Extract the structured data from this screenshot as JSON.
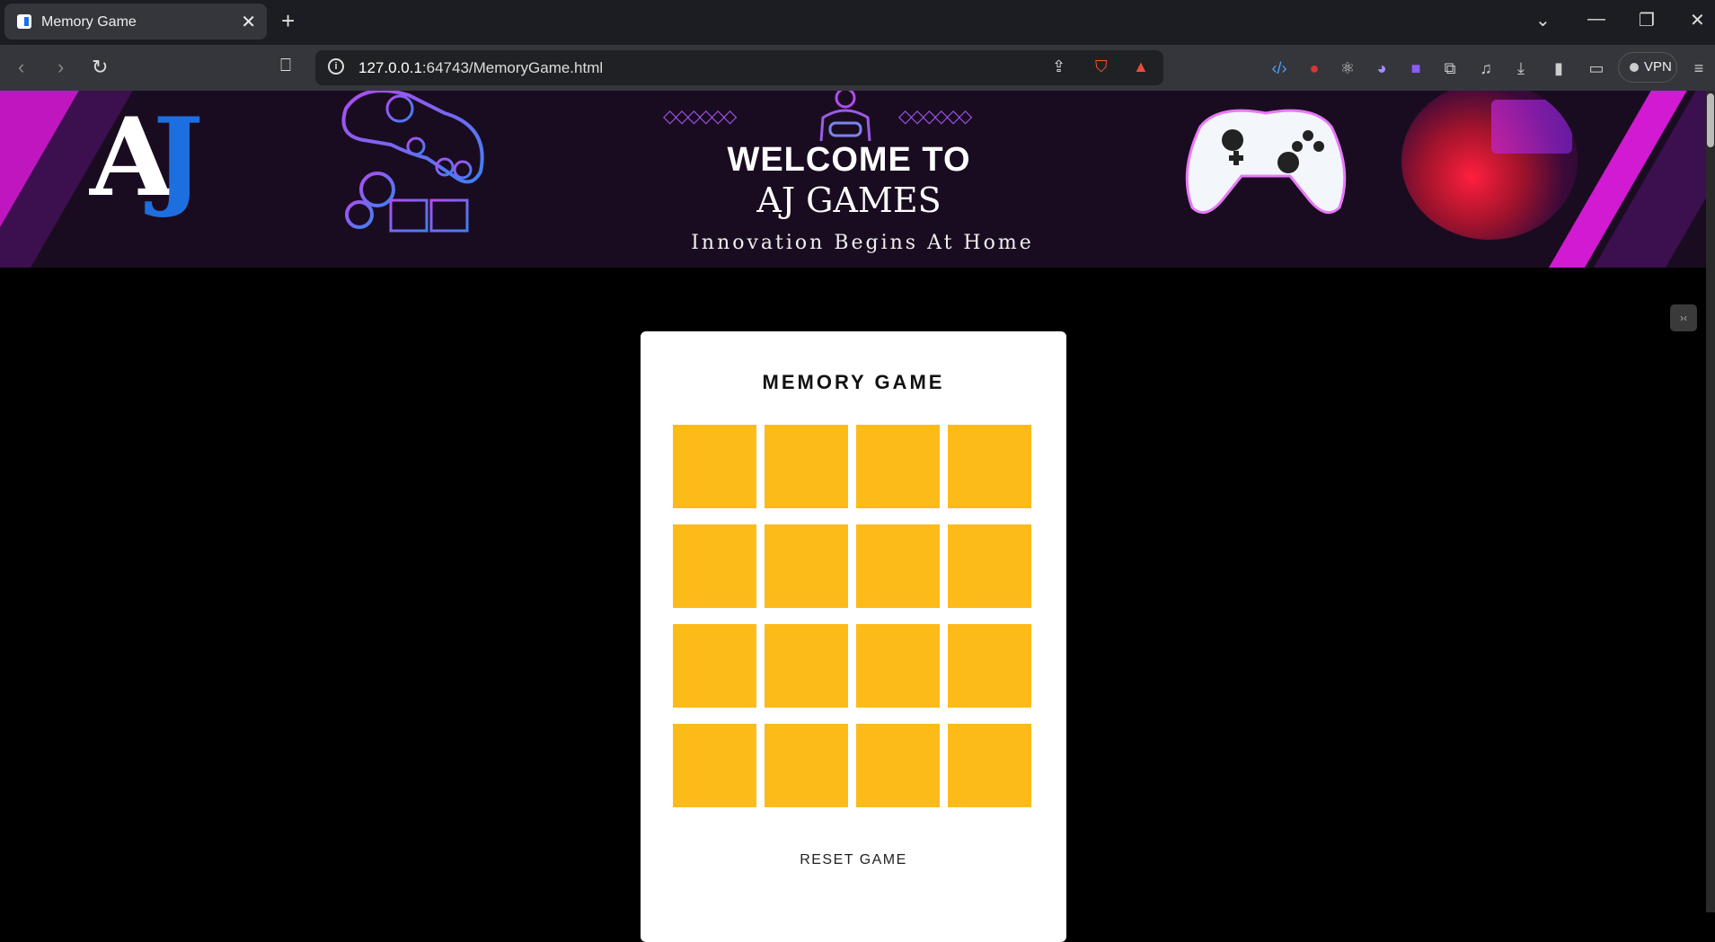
{
  "browser": {
    "tab_title": "Memory Game",
    "tab_close": "✕",
    "new_tab": "+",
    "url_host": "127.0.0.1",
    "url_rest": ":64743/MemoryGame.html",
    "vpn_label": "VPN"
  },
  "banner": {
    "title_line1": "WELCOME TO",
    "title_line2": "AJ GAMES",
    "tagline": "Innovation Begins At Home",
    "logo_letter_a": "A",
    "logo_letter_j": "J"
  },
  "game": {
    "title": "MEMORY GAME",
    "tiles": 16,
    "tile_color": "#fdbb1a",
    "reset_label": "RESET GAME"
  },
  "colors": {
    "page_bg": "#000000",
    "card_bg": "#ffffff",
    "banner_bg": "#1a0c20",
    "accent_magenta": "#c016c0",
    "accent_blue": "#1d6fe0"
  }
}
